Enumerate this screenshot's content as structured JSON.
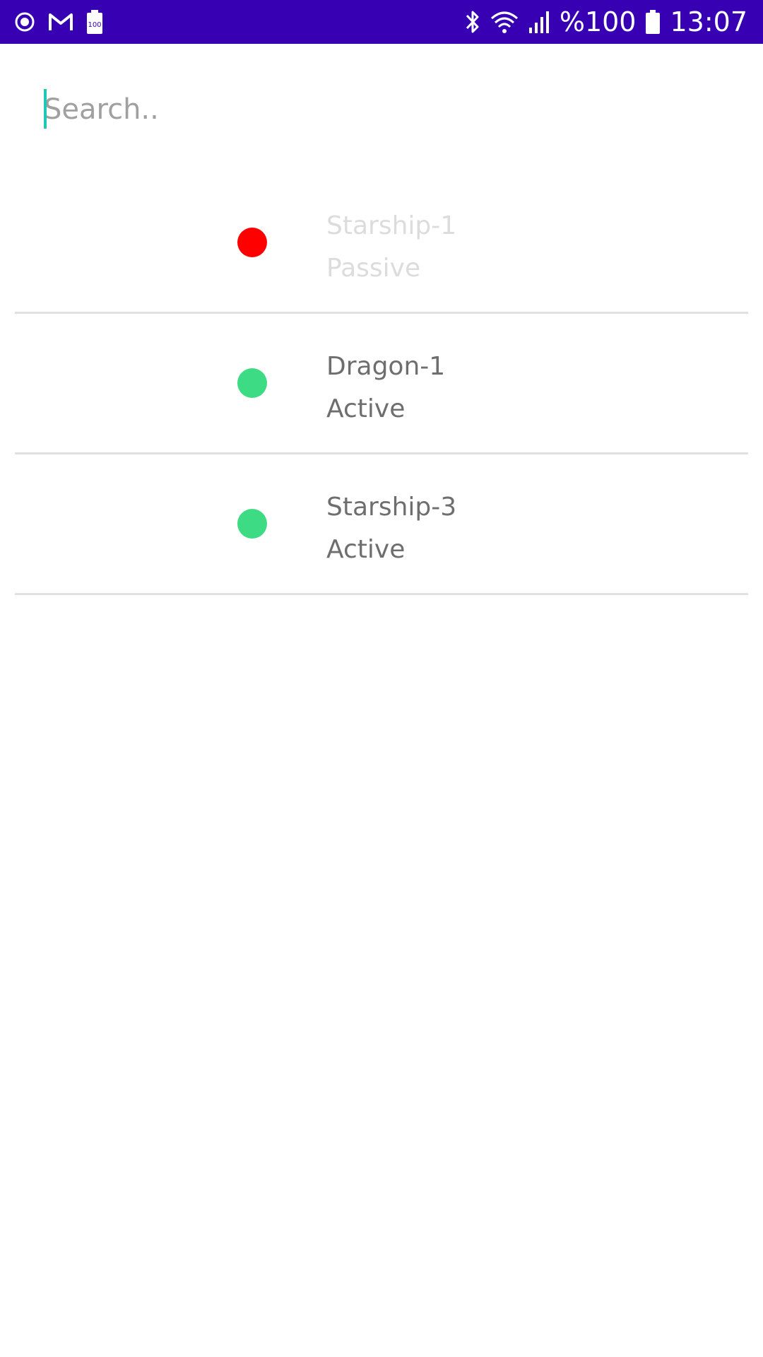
{
  "status_bar": {
    "battery_icon_label": "100",
    "battery_percent": "%100",
    "time": "13:07",
    "background_color": "#3700b3",
    "icons": [
      "record-icon",
      "gmail-icon",
      "battery-saver-icon",
      "bluetooth-icon",
      "wifi-icon",
      "signal-icon",
      "battery-icon"
    ]
  },
  "search": {
    "placeholder": "Search..",
    "value": "",
    "cursor_color": "#1ec8b4"
  },
  "items": [
    {
      "name": "Starship-1",
      "state": "Passive",
      "dot_color": "#ff0000",
      "dimmed": true
    },
    {
      "name": "Dragon-1",
      "state": "Active",
      "dot_color": "#3ddc84",
      "dimmed": false
    },
    {
      "name": "Starship-3",
      "state": "Active",
      "dot_color": "#3ddc84",
      "dimmed": false
    }
  ]
}
